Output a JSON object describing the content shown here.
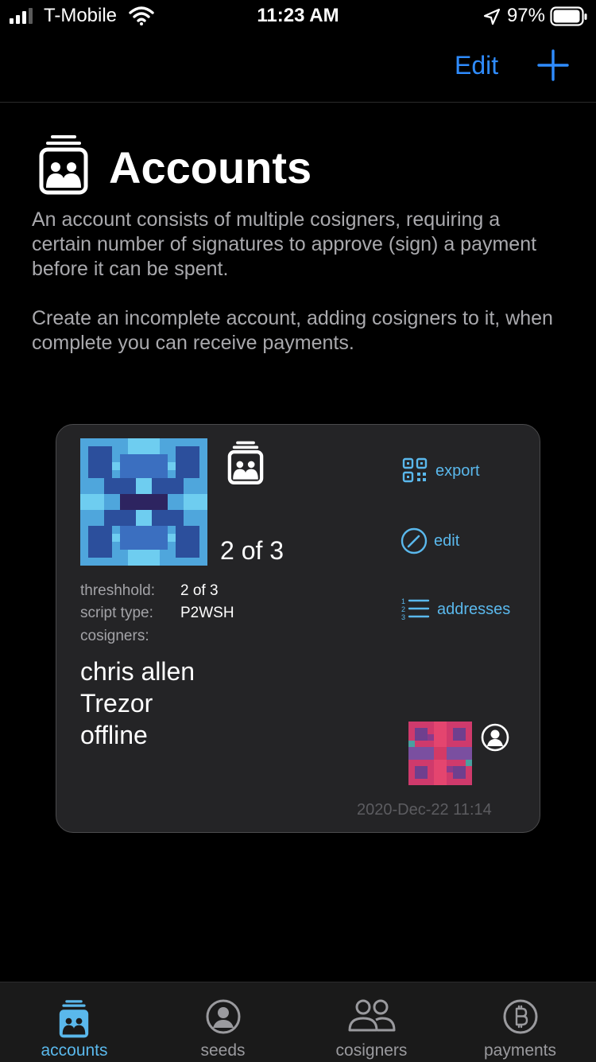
{
  "status_bar": {
    "carrier": "T-Mobile",
    "time": "11:23 AM",
    "battery": "97%"
  },
  "nav": {
    "edit_label": "Edit"
  },
  "page": {
    "title": "Accounts",
    "description_1": "An account consists of multiple cosigners, requiring a certain number of signatures to approve (sign) a payment before it can be spent.",
    "description_2": "Create an incomplete account, adding cosigners to it, when complete you can receive payments."
  },
  "account_card": {
    "quorum": "2 of 3",
    "threshold_label": "threshhold:",
    "threshold_value": "2 of 3",
    "script_type_label": "script type:",
    "script_type_value": "P2WSH",
    "cosigners_label": "cosigners:",
    "cosigners": [
      "chris allen",
      "Trezor",
      "offline"
    ],
    "actions": {
      "export": "export",
      "edit": "edit",
      "addresses": "addresses"
    },
    "date": "2020-Dec-22 11:14"
  },
  "tabs": [
    {
      "label": "accounts",
      "active": true
    },
    {
      "label": "seeds",
      "active": false
    },
    {
      "label": "cosigners",
      "active": false
    },
    {
      "label": "payments",
      "active": false
    }
  ],
  "colors": {
    "accent_blue": "#2f8cff",
    "action_blue": "#5ab8ec",
    "card_bg": "#242426",
    "secondary_text": "#a9a9ad"
  }
}
